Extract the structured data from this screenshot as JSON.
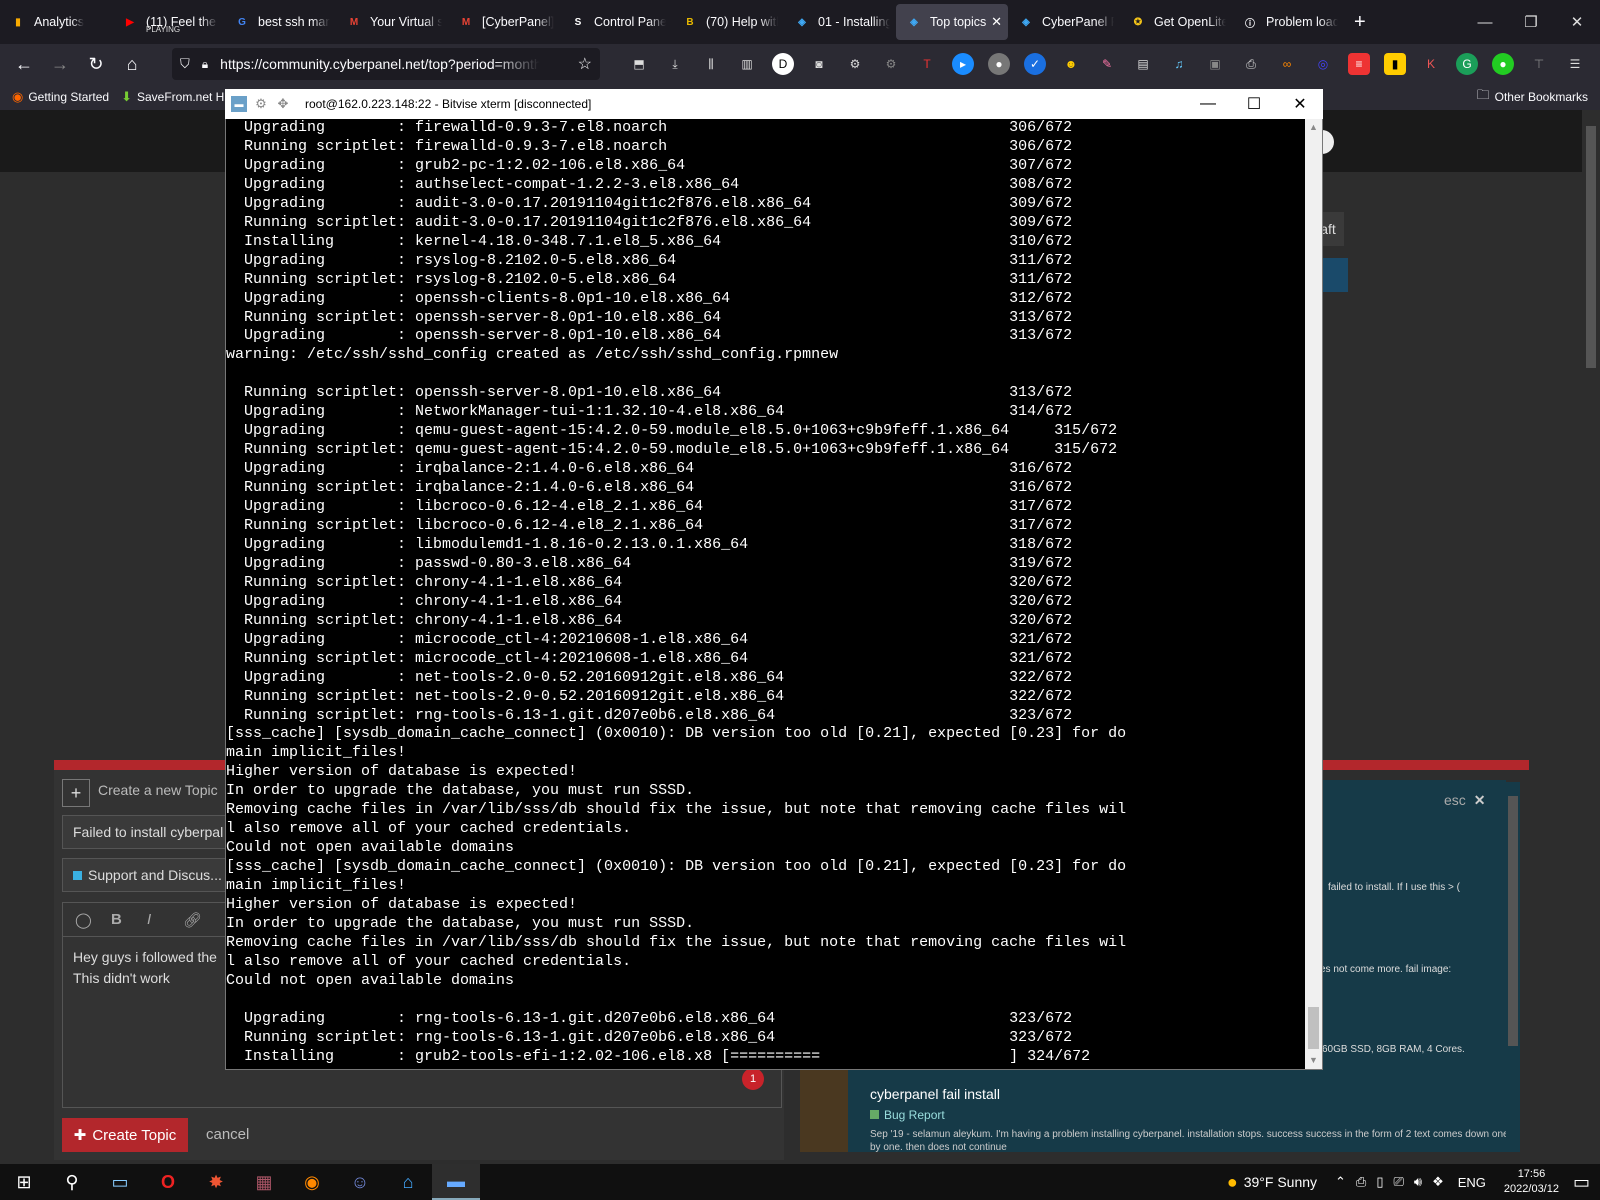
{
  "browser": {
    "tabs": [
      {
        "title": "Analytics",
        "icon": "analytics-icon",
        "color": "#f9ab00"
      },
      {
        "title": "(11) Feel the ...",
        "sub": "PLAYING",
        "icon": "youtube-icon",
        "color": "#ff0000"
      },
      {
        "title": "best ssh man...",
        "icon": "google-icon",
        "color": "#4285f4"
      },
      {
        "title": "Your Virtual s...",
        "icon": "gmail-icon",
        "color": "#ea4335"
      },
      {
        "title": "[CyberPanel] C...",
        "icon": "gmail-icon",
        "color": "#ea4335"
      },
      {
        "title": "Control Panel",
        "icon": "control-panel-icon",
        "color": "#ffffff"
      },
      {
        "title": "(70) Help with...",
        "icon": "bing-icon",
        "color": "#e6b800"
      },
      {
        "title": "01 - Installing...",
        "icon": "cyberpanel-icon",
        "color": "#3fa9f5"
      },
      {
        "title": "Top topics",
        "icon": "cyberpanel-icon",
        "color": "#3fa9f5",
        "active": true
      },
      {
        "title": "CyberPanel P...",
        "icon": "cyberpanel-icon",
        "color": "#3fa9f5"
      },
      {
        "title": "Get OpenLite...",
        "icon": "openlitespeed-icon",
        "color": "#f5c518"
      },
      {
        "title": "Problem load...",
        "icon": "info-icon",
        "color": "#fbfbfe"
      }
    ],
    "new_tab": "+",
    "url": "https://community.cyberpanel.net/top?period=monthly",
    "bookmarks": [
      {
        "label": "Getting Started",
        "icon": "firefox-icon"
      },
      {
        "label": "SaveFrom.net H...",
        "icon": "download-icon"
      }
    ],
    "other_bookmarks": "Other Bookmarks",
    "min": "—",
    "max": "❐",
    "close": "✕"
  },
  "forum": {
    "new_topic_label": "Create a new Topic",
    "title_value": "Failed to install cyberpal",
    "category": "Support and Discus...",
    "body_lines": [
      "Hey guys i followed the",
      "This didn't work"
    ],
    "create_button": "Create Topic",
    "cancel": "cancel",
    "notif_count": "1",
    "draft_label": "aft",
    "esc": "esc",
    "esc_close": "✕",
    "snip1": "failed to install. If I use this > (",
    "snip2": "es not come more. fail image:",
    "snip3": "60GB SSD, 8GB RAM, 4 Cores.",
    "result_title": "cyberpanel fail install",
    "result_category": "Bug Report",
    "result_desc": "Sep '19 - selamun aleykum. I'm having a problem installing cyberpanel. installation stops. success success in the form of 2 text comes down one by one. then does not continue"
  },
  "terminal": {
    "title": "root@162.0.223.148:22 - Bitvise xterm [disconnected]",
    "lines": [
      "  Upgrading        : firewalld-0.9.3-7.el8.noarch                                      306/672",
      "  Running scriptlet: firewalld-0.9.3-7.el8.noarch                                      306/672",
      "  Upgrading        : grub2-pc-1:2.02-106.el8.x86_64                                    307/672",
      "  Upgrading        : authselect-compat-1.2.2-3.el8.x86_64                              308/672",
      "  Upgrading        : audit-3.0-0.17.20191104git1c2f876.el8.x86_64                      309/672",
      "  Running scriptlet: audit-3.0-0.17.20191104git1c2f876.el8.x86_64                      309/672",
      "  Installing       : kernel-4.18.0-348.7.1.el8_5.x86_64                                310/672",
      "  Upgrading        : rsyslog-8.2102.0-5.el8.x86_64                                     311/672",
      "  Running scriptlet: rsyslog-8.2102.0-5.el8.x86_64                                     311/672",
      "  Upgrading        : openssh-clients-8.0p1-10.el8.x86_64                               312/672",
      "  Running scriptlet: openssh-server-8.0p1-10.el8.x86_64                                313/672",
      "  Upgrading        : openssh-server-8.0p1-10.el8.x86_64                                313/672",
      "warning: /etc/ssh/sshd_config created as /etc/ssh/sshd_config.rpmnew",
      "",
      "  Running scriptlet: openssh-server-8.0p1-10.el8.x86_64                                313/672",
      "  Upgrading        : NetworkManager-tui-1:1.32.10-4.el8.x86_64                         314/672",
      "  Upgrading        : qemu-guest-agent-15:4.2.0-59.module_el8.5.0+1063+c9b9feff.1.x86_64     315/672",
      "  Running scriptlet: qemu-guest-agent-15:4.2.0-59.module_el8.5.0+1063+c9b9feff.1.x86_64     315/672",
      "  Upgrading        : irqbalance-2:1.4.0-6.el8.x86_64                                   316/672",
      "  Running scriptlet: irqbalance-2:1.4.0-6.el8.x86_64                                   316/672",
      "  Upgrading        : libcroco-0.6.12-4.el8_2.1.x86_64                                  317/672",
      "  Running scriptlet: libcroco-0.6.12-4.el8_2.1.x86_64                                  317/672",
      "  Upgrading        : libmodulemd1-1.8.16-0.2.13.0.1.x86_64                             318/672",
      "  Upgrading        : passwd-0.80-3.el8.x86_64                                          319/672",
      "  Running scriptlet: chrony-4.1-1.el8.x86_64                                           320/672",
      "  Upgrading        : chrony-4.1-1.el8.x86_64                                           320/672",
      "  Running scriptlet: chrony-4.1-1.el8.x86_64                                           320/672",
      "  Upgrading        : microcode_ctl-4:20210608-1.el8.x86_64                             321/672",
      "  Running scriptlet: microcode_ctl-4:20210608-1.el8.x86_64                             321/672",
      "  Upgrading        : net-tools-2.0-0.52.20160912git.el8.x86_64                         322/672",
      "  Running scriptlet: net-tools-2.0-0.52.20160912git.el8.x86_64                         322/672",
      "  Running scriptlet: rng-tools-6.13-1.git.d207e0b6.el8.x86_64                          323/672",
      "[sss_cache] [sysdb_domain_cache_connect] (0x0010): DB version too old [0.21], expected [0.23] for do",
      "main implicit_files!",
      "Higher version of database is expected!",
      "In order to upgrade the database, you must run SSSD.",
      "Removing cache files in /var/lib/sss/db should fix the issue, but note that removing cache files wil",
      "l also remove all of your cached credentials.",
      "Could not open available domains",
      "[sss_cache] [sysdb_domain_cache_connect] (0x0010): DB version too old [0.21], expected [0.23] for do",
      "main implicit_files!",
      "Higher version of database is expected!",
      "In order to upgrade the database, you must run SSSD.",
      "Removing cache files in /var/lib/sss/db should fix the issue, but note that removing cache files wil",
      "l also remove all of your cached credentials.",
      "Could not open available domains",
      "",
      "  Upgrading        : rng-tools-6.13-1.git.d207e0b6.el8.x86_64                          323/672",
      "  Running scriptlet: rng-tools-6.13-1.git.d207e0b6.el8.x86_64                          323/672",
      "  Installing       : grub2-tools-efi-1:2.02-106.el8.x8 [==========                     ] 324/672"
    ]
  },
  "taskbar": {
    "weather": "39°F  Sunny",
    "lang": "ENG",
    "time": "17:56",
    "date": "2022/03/12"
  }
}
